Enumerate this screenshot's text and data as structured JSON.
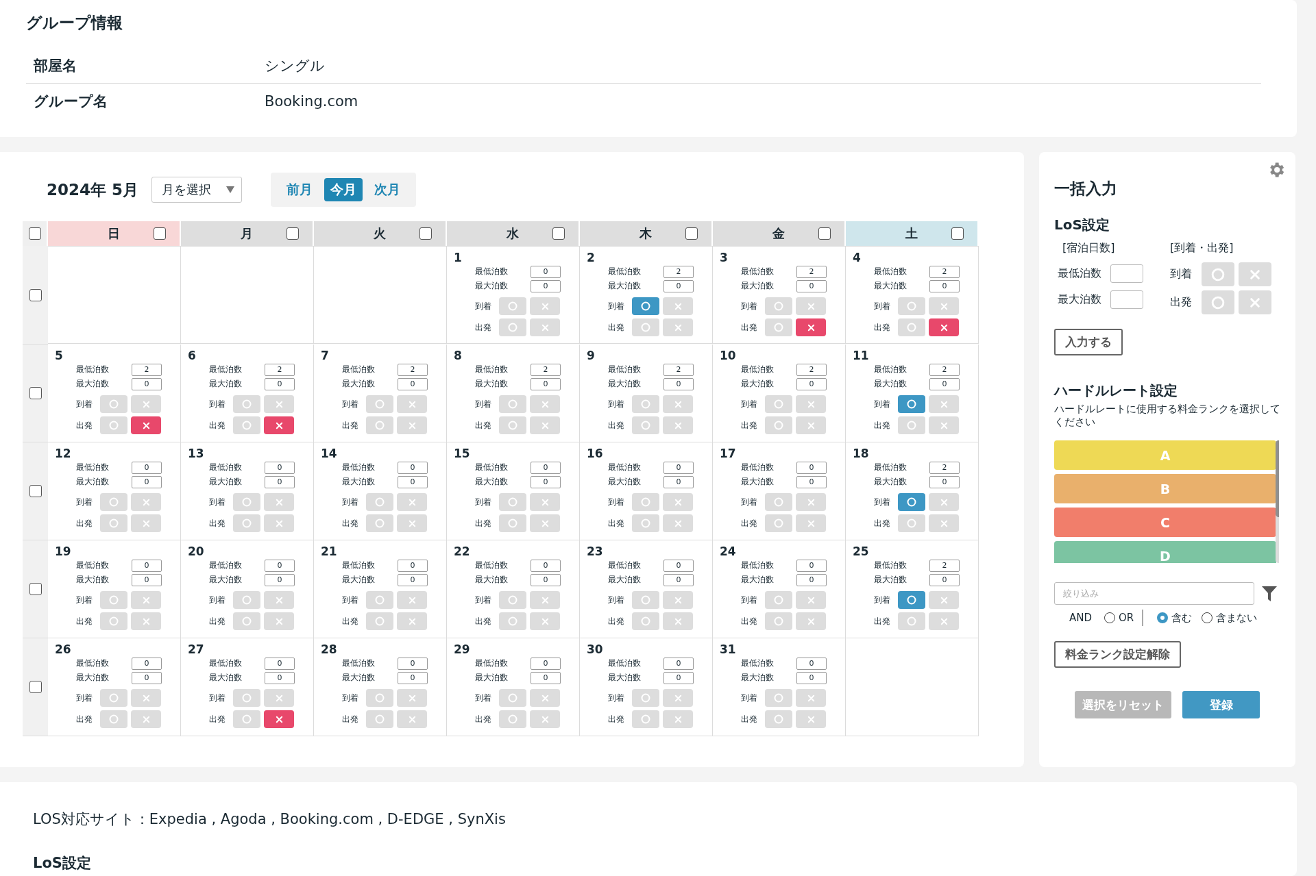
{
  "group_info": {
    "title": "グループ情報",
    "rows": [
      {
        "label": "部屋名",
        "value": "シングル"
      },
      {
        "label": "グループ名",
        "value": "Booking.com"
      }
    ]
  },
  "calendar": {
    "title": "2024年 5月",
    "month_select": "月を選択",
    "nav": [
      {
        "label": "前月",
        "selected": false
      },
      {
        "label": "今月",
        "selected": true
      },
      {
        "label": "次月",
        "selected": false
      }
    ],
    "select_all_checked": false,
    "weekdays": [
      {
        "label": "日",
        "color": "#f8d7d7",
        "checked": false
      },
      {
        "label": "月",
        "color": "#dedede",
        "checked": false
      },
      {
        "label": "火",
        "color": "#dedede",
        "checked": false
      },
      {
        "label": "水",
        "color": "#dedede",
        "checked": false
      },
      {
        "label": "木",
        "color": "#dedede",
        "checked": false
      },
      {
        "label": "金",
        "color": "#dedede",
        "checked": false
      },
      {
        "label": "土",
        "color": "#cfe6ec",
        "checked": false
      }
    ],
    "weeks": [
      {
        "checked": false,
        "days": [
          {
            "kind": "blank"
          },
          {
            "kind": "blank"
          },
          {
            "kind": "blank"
          },
          {
            "day": "1",
            "min_label": "最低泊数",
            "min": "0",
            "max_label": "最大泊数",
            "max": "0",
            "arrival_label": "到着",
            "arrival_ok": false,
            "arrival_ng": false,
            "departure_label": "出発",
            "departure_ok": false,
            "departure_ng": false
          },
          {
            "day": "2",
            "min_label": "最低泊数",
            "min": "2",
            "max_label": "最大泊数",
            "max": "0",
            "arrival_label": "到着",
            "arrival_ok": true,
            "arrival_ng": false,
            "departure_label": "出発",
            "departure_ok": false,
            "departure_ng": false
          },
          {
            "day": "3",
            "min_label": "最低泊数",
            "min": "2",
            "max_label": "最大泊数",
            "max": "0",
            "arrival_label": "到着",
            "arrival_ok": false,
            "arrival_ng": false,
            "departure_label": "出発",
            "departure_ok": false,
            "departure_ng": true
          },
          {
            "day": "4",
            "min_label": "最低泊数",
            "min": "2",
            "max_label": "最大泊数",
            "max": "0",
            "arrival_label": "到着",
            "arrival_ok": false,
            "arrival_ng": false,
            "departure_label": "出発",
            "departure_ok": false,
            "departure_ng": true
          }
        ]
      },
      {
        "checked": false,
        "days": [
          {
            "day": "5",
            "min_label": "最低泊数",
            "min": "2",
            "max_label": "最大泊数",
            "max": "0",
            "arrival_label": "到着",
            "arrival_ok": false,
            "arrival_ng": false,
            "departure_label": "出発",
            "departure_ok": false,
            "departure_ng": true
          },
          {
            "day": "6",
            "min_label": "最低泊数",
            "min": "2",
            "max_label": "最大泊数",
            "max": "0",
            "arrival_label": "到着",
            "arrival_ok": false,
            "arrival_ng": false,
            "departure_label": "出発",
            "departure_ok": false,
            "departure_ng": true
          },
          {
            "day": "7",
            "min_label": "最低泊数",
            "min": "2",
            "max_label": "最大泊数",
            "max": "0",
            "arrival_label": "到着",
            "arrival_ok": false,
            "arrival_ng": false,
            "departure_label": "出発",
            "departure_ok": false,
            "departure_ng": false
          },
          {
            "day": "8",
            "min_label": "最低泊数",
            "min": "2",
            "max_label": "最大泊数",
            "max": "0",
            "arrival_label": "到着",
            "arrival_ok": false,
            "arrival_ng": false,
            "departure_label": "出発",
            "departure_ok": false,
            "departure_ng": false
          },
          {
            "day": "9",
            "min_label": "最低泊数",
            "min": "2",
            "max_label": "最大泊数",
            "max": "0",
            "arrival_label": "到着",
            "arrival_ok": false,
            "arrival_ng": false,
            "departure_label": "出発",
            "departure_ok": false,
            "departure_ng": false
          },
          {
            "day": "10",
            "min_label": "最低泊数",
            "min": "2",
            "max_label": "最大泊数",
            "max": "0",
            "arrival_label": "到着",
            "arrival_ok": false,
            "arrival_ng": false,
            "departure_label": "出発",
            "departure_ok": false,
            "departure_ng": false
          },
          {
            "day": "11",
            "min_label": "最低泊数",
            "min": "2",
            "max_label": "最大泊数",
            "max": "0",
            "arrival_label": "到着",
            "arrival_ok": true,
            "arrival_ng": false,
            "departure_label": "出発",
            "departure_ok": false,
            "departure_ng": false
          }
        ]
      },
      {
        "checked": false,
        "days": [
          {
            "day": "12",
            "min_label": "最低泊数",
            "min": "0",
            "max_label": "最大泊数",
            "max": "0",
            "arrival_label": "到着",
            "arrival_ok": false,
            "arrival_ng": false,
            "departure_label": "出発",
            "departure_ok": false,
            "departure_ng": false
          },
          {
            "day": "13",
            "min_label": "最低泊数",
            "min": "0",
            "max_label": "最大泊数",
            "max": "0",
            "arrival_label": "到着",
            "arrival_ok": false,
            "arrival_ng": false,
            "departure_label": "出発",
            "departure_ok": false,
            "departure_ng": false
          },
          {
            "day": "14",
            "min_label": "最低泊数",
            "min": "0",
            "max_label": "最大泊数",
            "max": "0",
            "arrival_label": "到着",
            "arrival_ok": false,
            "arrival_ng": false,
            "departure_label": "出発",
            "departure_ok": false,
            "departure_ng": false
          },
          {
            "day": "15",
            "min_label": "最低泊数",
            "min": "0",
            "max_label": "最大泊数",
            "max": "0",
            "arrival_label": "到着",
            "arrival_ok": false,
            "arrival_ng": false,
            "departure_label": "出発",
            "departure_ok": false,
            "departure_ng": false
          },
          {
            "day": "16",
            "min_label": "最低泊数",
            "min": "0",
            "max_label": "最大泊数",
            "max": "0",
            "arrival_label": "到着",
            "arrival_ok": false,
            "arrival_ng": false,
            "departure_label": "出発",
            "departure_ok": false,
            "departure_ng": false
          },
          {
            "day": "17",
            "min_label": "最低泊数",
            "min": "0",
            "max_label": "最大泊数",
            "max": "0",
            "arrival_label": "到着",
            "arrival_ok": false,
            "arrival_ng": false,
            "departure_label": "出発",
            "departure_ok": false,
            "departure_ng": false
          },
          {
            "day": "18",
            "min_label": "最低泊数",
            "min": "2",
            "max_label": "最大泊数",
            "max": "0",
            "arrival_label": "到着",
            "arrival_ok": true,
            "arrival_ng": false,
            "departure_label": "出発",
            "departure_ok": false,
            "departure_ng": false
          }
        ]
      },
      {
        "checked": false,
        "days": [
          {
            "day": "19",
            "min_label": "最低泊数",
            "min": "0",
            "max_label": "最大泊数",
            "max": "0",
            "arrival_label": "到着",
            "arrival_ok": false,
            "arrival_ng": false,
            "departure_label": "出発",
            "departure_ok": false,
            "departure_ng": false
          },
          {
            "day": "20",
            "min_label": "最低泊数",
            "min": "0",
            "max_label": "最大泊数",
            "max": "0",
            "arrival_label": "到着",
            "arrival_ok": false,
            "arrival_ng": false,
            "departure_label": "出発",
            "departure_ok": false,
            "departure_ng": false
          },
          {
            "day": "21",
            "min_label": "最低泊数",
            "min": "0",
            "max_label": "最大泊数",
            "max": "0",
            "arrival_label": "到着",
            "arrival_ok": false,
            "arrival_ng": false,
            "departure_label": "出発",
            "departure_ok": false,
            "departure_ng": false
          },
          {
            "day": "22",
            "min_label": "最低泊数",
            "min": "0",
            "max_label": "最大泊数",
            "max": "0",
            "arrival_label": "到着",
            "arrival_ok": false,
            "arrival_ng": false,
            "departure_label": "出発",
            "departure_ok": false,
            "departure_ng": false
          },
          {
            "day": "23",
            "min_label": "最低泊数",
            "min": "0",
            "max_label": "最大泊数",
            "max": "0",
            "arrival_label": "到着",
            "arrival_ok": false,
            "arrival_ng": false,
            "departure_label": "出発",
            "departure_ok": false,
            "departure_ng": false
          },
          {
            "day": "24",
            "min_label": "最低泊数",
            "min": "0",
            "max_label": "最大泊数",
            "max": "0",
            "arrival_label": "到着",
            "arrival_ok": false,
            "arrival_ng": false,
            "departure_label": "出発",
            "departure_ok": false,
            "departure_ng": false
          },
          {
            "day": "25",
            "min_label": "最低泊数",
            "min": "2",
            "max_label": "最大泊数",
            "max": "0",
            "arrival_label": "到着",
            "arrival_ok": true,
            "arrival_ng": false,
            "departure_label": "出発",
            "departure_ok": false,
            "departure_ng": false
          }
        ]
      },
      {
        "checked": false,
        "days": [
          {
            "day": "26",
            "min_label": "最低泊数",
            "min": "0",
            "max_label": "最大泊数",
            "max": "0",
            "arrival_label": "到着",
            "arrival_ok": false,
            "arrival_ng": false,
            "departure_label": "出発",
            "departure_ok": false,
            "departure_ng": false
          },
          {
            "day": "27",
            "min_label": "最低泊数",
            "min": "0",
            "max_label": "最大泊数",
            "max": "0",
            "arrival_label": "到着",
            "arrival_ok": false,
            "arrival_ng": false,
            "departure_label": "出発",
            "departure_ok": false,
            "departure_ng": true
          },
          {
            "day": "28",
            "min_label": "最低泊数",
            "min": "0",
            "max_label": "最大泊数",
            "max": "0",
            "arrival_label": "到着",
            "arrival_ok": false,
            "arrival_ng": false,
            "departure_label": "出発",
            "departure_ok": false,
            "departure_ng": false
          },
          {
            "day": "29",
            "min_label": "最低泊数",
            "min": "0",
            "max_label": "最大泊数",
            "max": "0",
            "arrival_label": "到着",
            "arrival_ok": false,
            "arrival_ng": false,
            "departure_label": "出発",
            "departure_ok": false,
            "departure_ng": false
          },
          {
            "day": "30",
            "min_label": "最低泊数",
            "min": "0",
            "max_label": "最大泊数",
            "max": "0",
            "arrival_label": "到着",
            "arrival_ok": false,
            "arrival_ng": false,
            "departure_label": "出発",
            "departure_ok": false,
            "departure_ng": false
          },
          {
            "day": "31",
            "min_label": "最低泊数",
            "min": "0",
            "max_label": "最大泊数",
            "max": "0",
            "arrival_label": "到着",
            "arrival_ok": false,
            "arrival_ng": false,
            "departure_label": "出発",
            "departure_ok": false,
            "departure_ng": false
          },
          {
            "kind": "blank"
          }
        ]
      }
    ]
  },
  "bulk_input": {
    "title": "一括入力",
    "los": {
      "title": "LoS設定",
      "stay_heading": "[宿泊日数]",
      "arrdep_heading": "[到着・出発]",
      "min_label": "最低泊数",
      "max_label": "最大泊数",
      "arrival_label": "到着",
      "departure_label": "出発",
      "arrival_ok": false,
      "arrival_ng": false,
      "departure_ok": false,
      "departure_ng": false,
      "submit": "入力する"
    },
    "hurdle": {
      "title": "ハードルレート設定",
      "description": "ハードルレートに使用する料金ランクを選択してください",
      "ranks": [
        {
          "label": "A",
          "color": "#eed955"
        },
        {
          "label": "B",
          "color": "#e9b06c"
        },
        {
          "label": "C",
          "color": "#f17e6b"
        },
        {
          "label": "D",
          "color": "#7cc4a2"
        }
      ],
      "filter_placeholder": "絞り込み",
      "and_label": "AND",
      "logic": [
        {
          "label": "OR",
          "selected": false
        }
      ],
      "match": [
        {
          "label": "含む",
          "selected": true
        },
        {
          "label": "含まない",
          "selected": false
        }
      ],
      "clear_button": "料金ランク設定解除"
    },
    "reset_button": "選択をリセット",
    "register_button": "登録"
  },
  "footer": {
    "sites_text": "LOS対応サイト：Expedia , Agoda , Booking.com , D-EDGE , SynXis",
    "los_title": "LoS設定"
  }
}
